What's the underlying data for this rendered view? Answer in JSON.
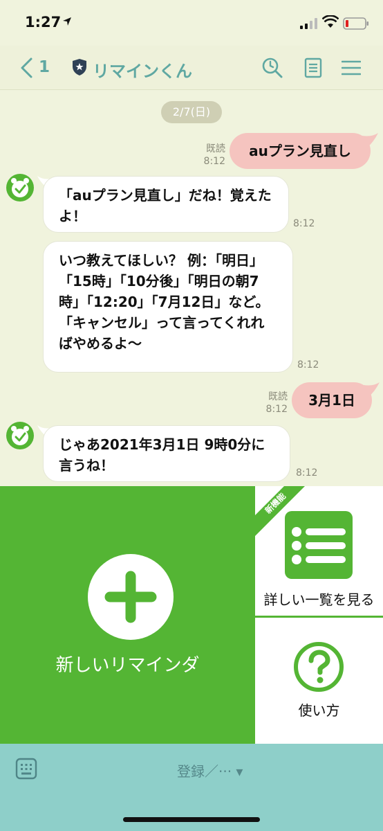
{
  "status": {
    "time": "1:27"
  },
  "header": {
    "back_count": "1",
    "title": "リマインくん"
  },
  "date_chip": "2/7(日)",
  "messages": [
    {
      "from": "me",
      "text": "auプラン見直し",
      "read": "既読",
      "time": "8:12"
    },
    {
      "from": "bot",
      "text": "「auプラン見直し」だね！覚えたよ！",
      "time": "8:12"
    },
    {
      "from": "bot",
      "text": "いつ教えてほしい？ 例：「明日」「15時」「10分後」「明日の朝7時」「12:20」「7月12日」など。「キャンセル」って言ってくれればやめるよ〜",
      "time": "8:12"
    },
    {
      "from": "me",
      "text": "3月1日",
      "read": "既読",
      "time": "8:12"
    },
    {
      "from": "bot",
      "text": "じゃあ2021年3月1日 9時0分に言うね！",
      "time": "8:12"
    }
  ],
  "panel": {
    "new_reminder": "新しいリマインダ",
    "ribbon": "新機能",
    "list_view": "詳しい一覧を見る",
    "howto": "使い方"
  },
  "bottom": {
    "menu_label": "登録／··· ▾"
  },
  "colors": {
    "accent": "#5fa8a2",
    "green": "#54b534",
    "sent_bubble": "#f5c4bf",
    "chat_bg": "#f0f3dd",
    "bottom_bar": "#8ecfc9"
  }
}
